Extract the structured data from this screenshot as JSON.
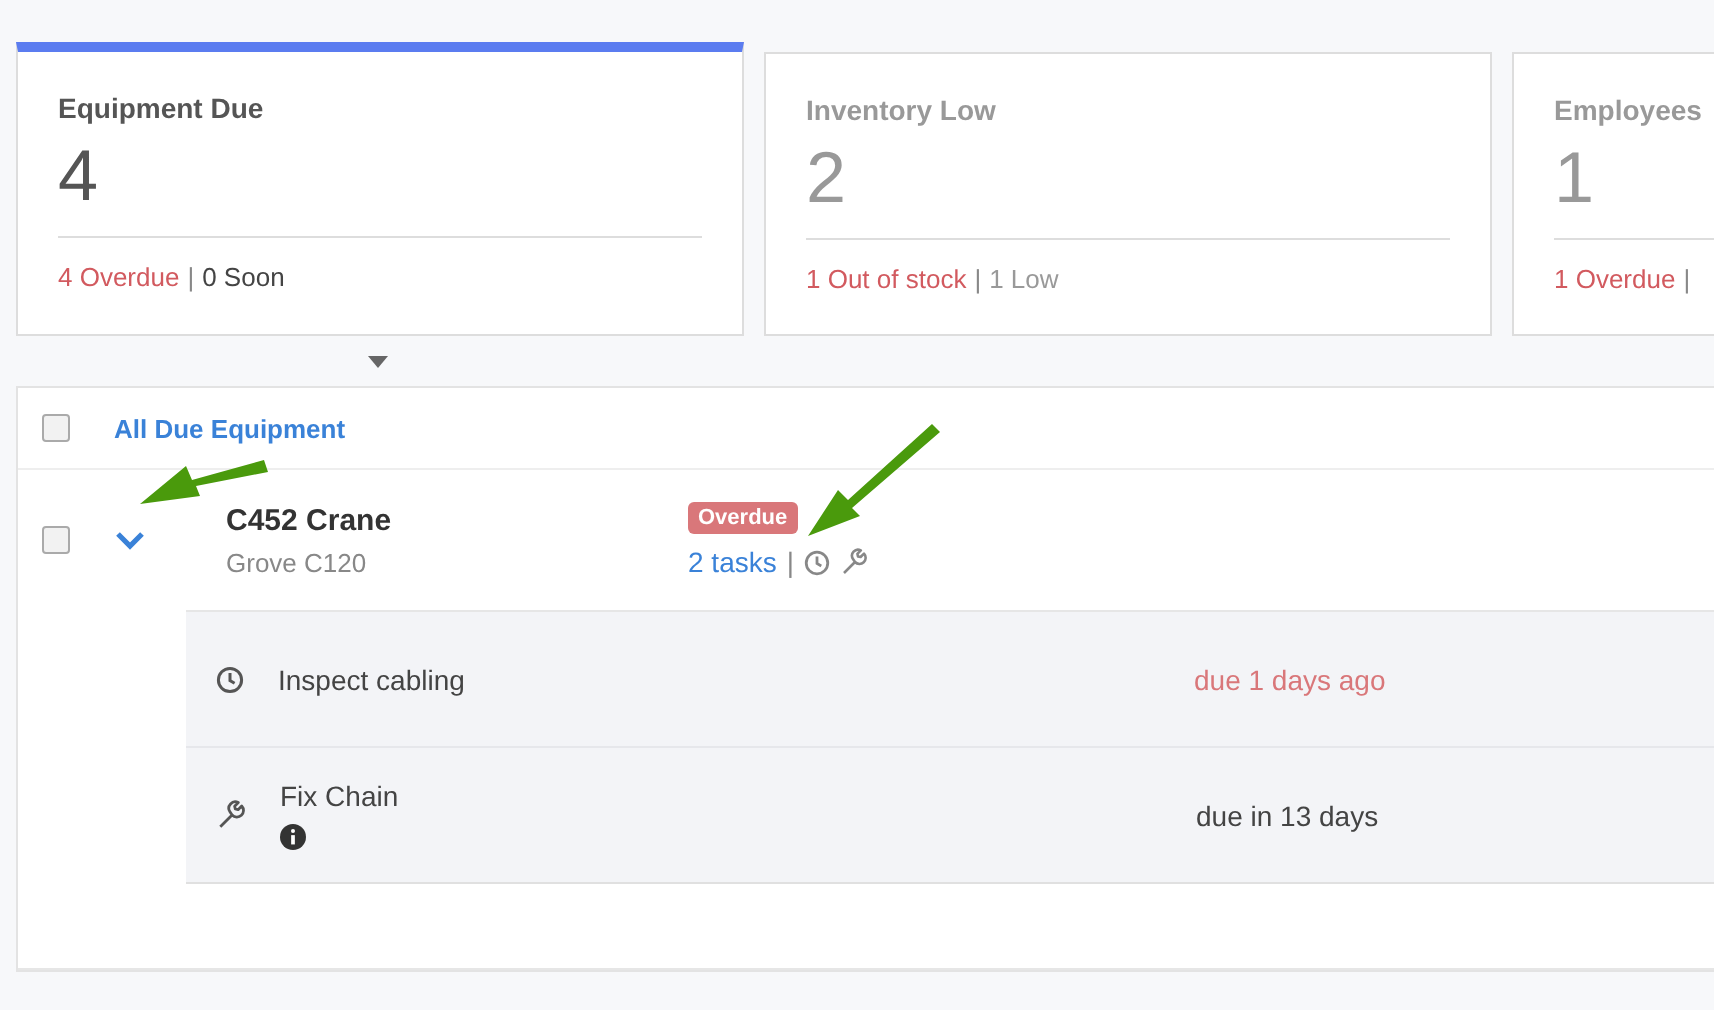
{
  "cards": [
    {
      "title": "Equipment Due",
      "count": "4",
      "selected": true,
      "alert": "4 Overdue",
      "separator": "|",
      "other": "0 Soon"
    },
    {
      "title": "Inventory Low",
      "count": "2",
      "selected": false,
      "alert": "1 Out of stock",
      "separator": "|",
      "other": "1 Low"
    },
    {
      "title": "Employees",
      "count": "1",
      "selected": false,
      "alert": "1 Overdue",
      "separator": "|"
    }
  ],
  "table": {
    "header": {
      "label": "All Due Equipment",
      "checked": false
    },
    "rows": [
      {
        "name": "C452 Crane",
        "model": "Grove C120",
        "checked": false,
        "expanded": true,
        "badge": "Overdue",
        "tasks_link": "2 tasks",
        "separator": "|",
        "tasks": [
          {
            "kind": "inspection",
            "name": "Inspect cabling",
            "due": "due 1 days ago",
            "overdue": true,
            "info": false
          },
          {
            "kind": "repair",
            "name": "Fix Chain",
            "due": "due in 13 days",
            "overdue": false,
            "info": true
          }
        ]
      }
    ]
  }
}
